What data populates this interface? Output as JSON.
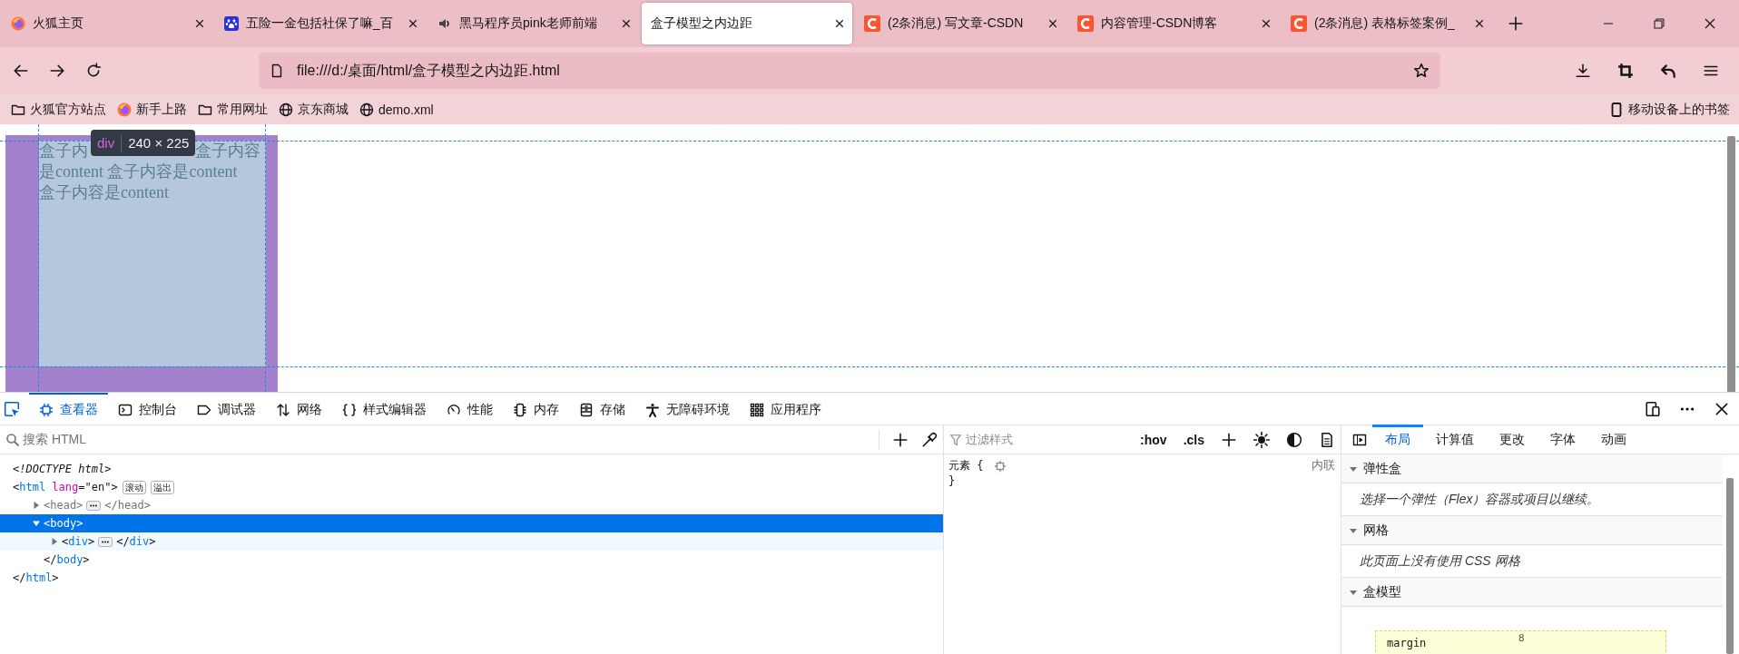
{
  "tabs": [
    {
      "title": "火狐主页",
      "kind": "firefox",
      "selected": false
    },
    {
      "title": "五险一金包括社保了嘛_百",
      "kind": "paw",
      "selected": false
    },
    {
      "title": "黑马程序员pink老师前端",
      "kind": "audio",
      "selected": false
    },
    {
      "title": "盒子模型之内边距",
      "kind": "none",
      "selected": true
    },
    {
      "title": "(2条消息) 写文章-CSDN",
      "kind": "csdn",
      "selected": false
    },
    {
      "title": "内容管理-CSDN博客",
      "kind": "csdn",
      "selected": false
    },
    {
      "title": "(2条消息) 表格标签案例_",
      "kind": "csdn",
      "selected": false
    }
  ],
  "address_bar": {
    "url": "file:///d:/桌面/html/盒子模型之内边距.html"
  },
  "bookmarks": [
    {
      "label": "火狐官方站点",
      "kind": "folder"
    },
    {
      "label": "新手上路",
      "kind": "firefox"
    },
    {
      "label": "常用网址",
      "kind": "folder"
    },
    {
      "label": "京东商城",
      "kind": "globe"
    },
    {
      "label": "demo.xml",
      "kind": "globe"
    }
  ],
  "mobile_bookmarks": "移动设备上的书签",
  "page": {
    "content_lines": [
      [
        "盒子内",
        "盒子内容"
      ],
      [
        "是content 盒子内容是content"
      ],
      [
        "盒子内容是content"
      ]
    ],
    "tooltip": {
      "tag": "div",
      "size": "240 × 225"
    }
  },
  "devtools": {
    "tools": [
      {
        "label": "查看器",
        "kind": "inspector",
        "selected": true
      },
      {
        "label": "控制台",
        "kind": "console",
        "selected": false
      },
      {
        "label": "调试器",
        "kind": "debugger",
        "selected": false
      },
      {
        "label": "网络",
        "kind": "network",
        "selected": false
      },
      {
        "label": "样式编辑器",
        "kind": "styles",
        "selected": false
      },
      {
        "label": "性能",
        "kind": "performance",
        "selected": false
      },
      {
        "label": "内存",
        "kind": "memory",
        "selected": false
      },
      {
        "label": "存储",
        "kind": "storage",
        "selected": false
      },
      {
        "label": "无障碍环境",
        "kind": "accessibility",
        "selected": false
      },
      {
        "label": "应用程序",
        "kind": "application",
        "selected": false
      }
    ],
    "search": {
      "placeholder": "搜索 HTML"
    },
    "tree": [
      {
        "tokens": [
          {
            "kind": "doctype",
            "text": "<!DOCTYPE html>"
          }
        ],
        "selected": false
      },
      {
        "tokens": [
          {
            "kind": "punct",
            "text": "<"
          },
          {
            "kind": "tag",
            "text": "html"
          },
          {
            "kind": "attr",
            "text": " lang"
          },
          {
            "kind": "punct",
            "text": "="
          },
          {
            "kind": "value",
            "text": "\"en\""
          },
          {
            "kind": "punct",
            "text": ">"
          }
        ],
        "badges": [
          "滚动",
          "溢出"
        ],
        "selected": false,
        "closing": [
          {
            "kind": "punct",
            "text": "</"
          },
          {
            "kind": "tag",
            "text": "html"
          },
          {
            "kind": "punct",
            "text": ">"
          }
        ],
        "children": [
          {
            "tokens": [
              {
                "kind": "dim",
                "text": "<head>"
              }
            ],
            "closing": [
              {
                "kind": "dim",
                "text": "</head>"
              }
            ],
            "expanded": false,
            "selected": false
          },
          {
            "tokens": [
              {
                "kind": "punct",
                "text": "<"
              },
              {
                "kind": "tag",
                "text": "body"
              },
              {
                "kind": "punct",
                "text": ">"
              }
            ],
            "expanded": true,
            "selected": true,
            "closing": [
              {
                "kind": "punct",
                "text": "</"
              },
              {
                "kind": "tag",
                "text": "body"
              },
              {
                "kind": "punct",
                "text": ">"
              }
            ],
            "children": [
              {
                "tokens": [
                  {
                    "kind": "punct",
                    "text": "<"
                  },
                  {
                    "kind": "tag",
                    "text": "div"
                  },
                  {
                    "kind": "punct",
                    "text": ">"
                  }
                ],
                "closing": [
                  {
                    "kind": "punct",
                    "text": "</"
                  },
                  {
                    "kind": "tag",
                    "text": "div"
                  },
                  {
                    "kind": "punct",
                    "text": ">"
                  }
                ],
                "expanded": false,
                "selected": false,
                "hovered": true
              }
            ]
          }
        ]
      }
    ],
    "rules": {
      "filter_placeholder": "过滤样式",
      "toggles": [
        ":hov",
        ".cls"
      ],
      "selector": "元素 {",
      "close": "}",
      "source": "内联"
    },
    "sidebar_tabs": [
      {
        "label": "布局",
        "selected": true
      },
      {
        "label": "计算值",
        "selected": false
      },
      {
        "label": "更改",
        "selected": false
      },
      {
        "label": "字体",
        "selected": false
      },
      {
        "label": "动画",
        "selected": false
      }
    ],
    "sections": [
      {
        "title": "弹性盒",
        "expanded": true,
        "kind": "note",
        "text": "选择一个弹性（Flex）容器或项目以继续。"
      },
      {
        "title": "网格",
        "expanded": true,
        "kind": "note",
        "text": "此页面上没有使用 CSS 网格"
      },
      {
        "title": "盒模型",
        "expanded": true,
        "kind": "boxmodel",
        "label": "margin",
        "value": "8"
      }
    ]
  }
}
